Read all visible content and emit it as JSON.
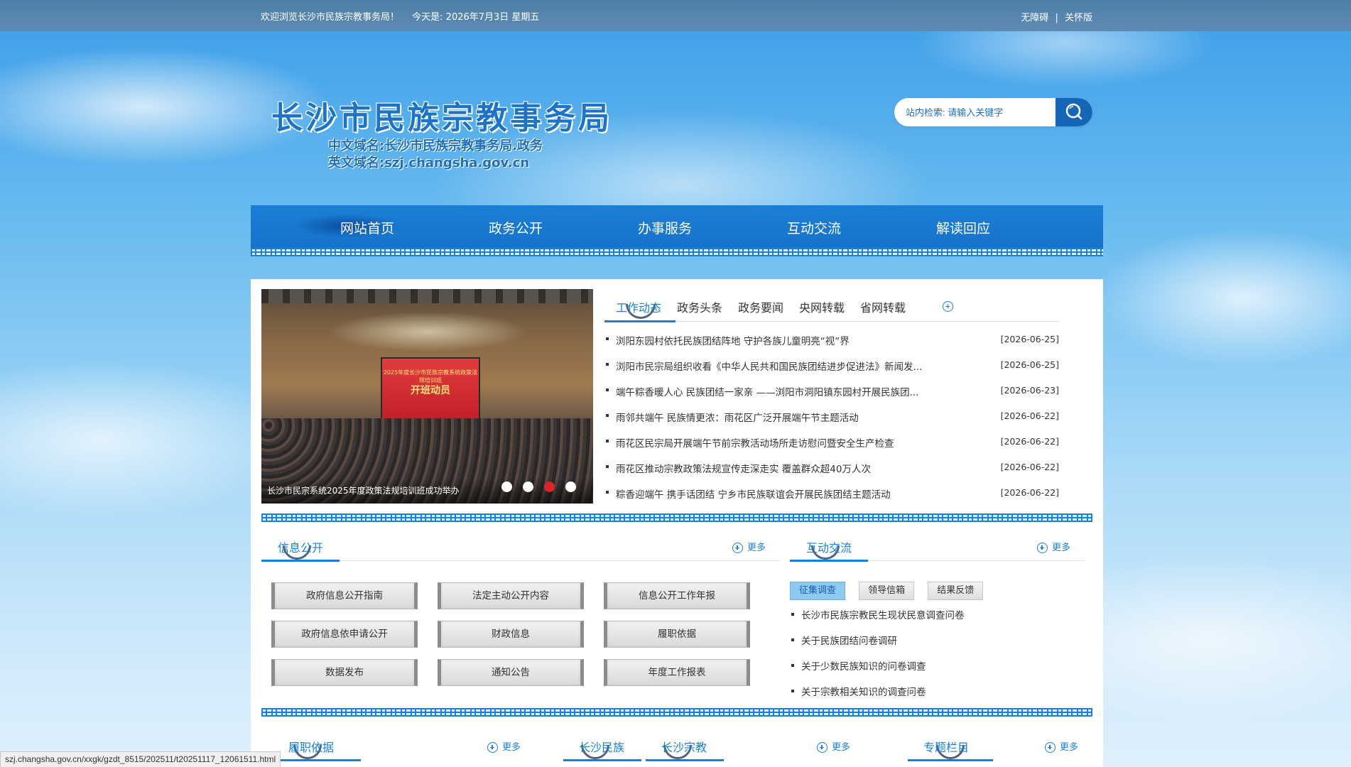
{
  "topbar": {
    "welcome": "欢迎浏览长沙市民族宗教事务局！",
    "date_text": "今天是: 2026年7月3日 星期五",
    "accessibility": "无障碍",
    "separator": "|",
    "elder_mode": "关怀版"
  },
  "logo": {
    "title": "长沙市民族宗教事务局",
    "cn_domain": "中文域名:长沙市民族宗教事务局.政务",
    "en_domain": "英文域名:szj.changsha.gov.cn"
  },
  "search": {
    "placeholder": "站内检索: 请输入关键字",
    "icon": "search-icon"
  },
  "nav": {
    "items": [
      "网站首页",
      "政务公开",
      "办事服务",
      "互动交流",
      "解读回应"
    ],
    "active": 0
  },
  "slider": {
    "caption": "长沙市民宗系统2025年度政策法规培训班成功举办",
    "screen_line1": "2025年度长沙市民族宗教系统政策法规培训班",
    "screen_line2": "开班动员",
    "dot_count": 4,
    "active_dot": 2,
    "accent_color": "#d8242a"
  },
  "news": {
    "tabs": [
      "工作动态",
      "政务头条",
      "政务要闻",
      "央网转载",
      "省网转载"
    ],
    "active_tab": 0,
    "items": [
      {
        "title": "浏阳东园村依托民族团结阵地 守护各族儿童明亮“视”界",
        "date": "[2026-06-25]"
      },
      {
        "title": "浏阳市民宗局组织收看《中华人民共和国民族团结进步促进法》新闻发...",
        "date": "[2026-06-25]"
      },
      {
        "title": "端午粽香暖人心 民族团结一家亲 ——浏阳市洞阳镇东园村开展民族团...",
        "date": "[2026-06-23]"
      },
      {
        "title": "雨邻共端午 民族情更浓：雨花区广泛开展端午节主题活动",
        "date": "[2026-06-22]"
      },
      {
        "title": "雨花区民宗局开展端午节前宗教活动场所走访慰问暨安全生产检查",
        "date": "[2026-06-22]"
      },
      {
        "title": "雨花区推动宗教政策法规宣传走深走实 覆盖群众超40万人次",
        "date": "[2026-06-22]"
      },
      {
        "title": "粽香迎端午 携手话团结 宁乡市民族联谊会开展民族团结主题活动",
        "date": "[2026-06-22]"
      }
    ]
  },
  "info": {
    "title": "信息公开",
    "more": "更多",
    "buttons": [
      "政府信息公开指南",
      "法定主动公开内容",
      "信息公开工作年报",
      "政府信息依申请公开",
      "财政信息",
      "履职依据",
      "数据发布",
      "通知公告",
      "年度工作报表"
    ]
  },
  "interact": {
    "title": "互动交流",
    "more": "更多",
    "subtabs": [
      "征集调查",
      "领导信箱",
      "结果反馈"
    ],
    "active_subtab": 0,
    "items": [
      "长沙市民族宗教民生现状民意调查问卷",
      "关于民族团结问卷调研",
      "关于少数民族知识的问卷调查",
      "关于宗教相关知识的调查问卷"
    ]
  },
  "bottom": {
    "duty": {
      "title": "履职依据",
      "more": "更多"
    },
    "minzu": {
      "title": "长沙民族"
    },
    "zongjiao": {
      "title": "长沙宗教",
      "more": "更多"
    },
    "special": {
      "title": "专题栏目",
      "more": "更多"
    }
  },
  "statusbar": {
    "url": "szj.changsha.gov.cn/xxgk/gzdt_8515/202511/t20251117_12061511.html"
  },
  "colors": {
    "brand_blue": "#1a7fd6",
    "nav_blue": "#1570c8",
    "topbar": "#5d8ab3"
  }
}
